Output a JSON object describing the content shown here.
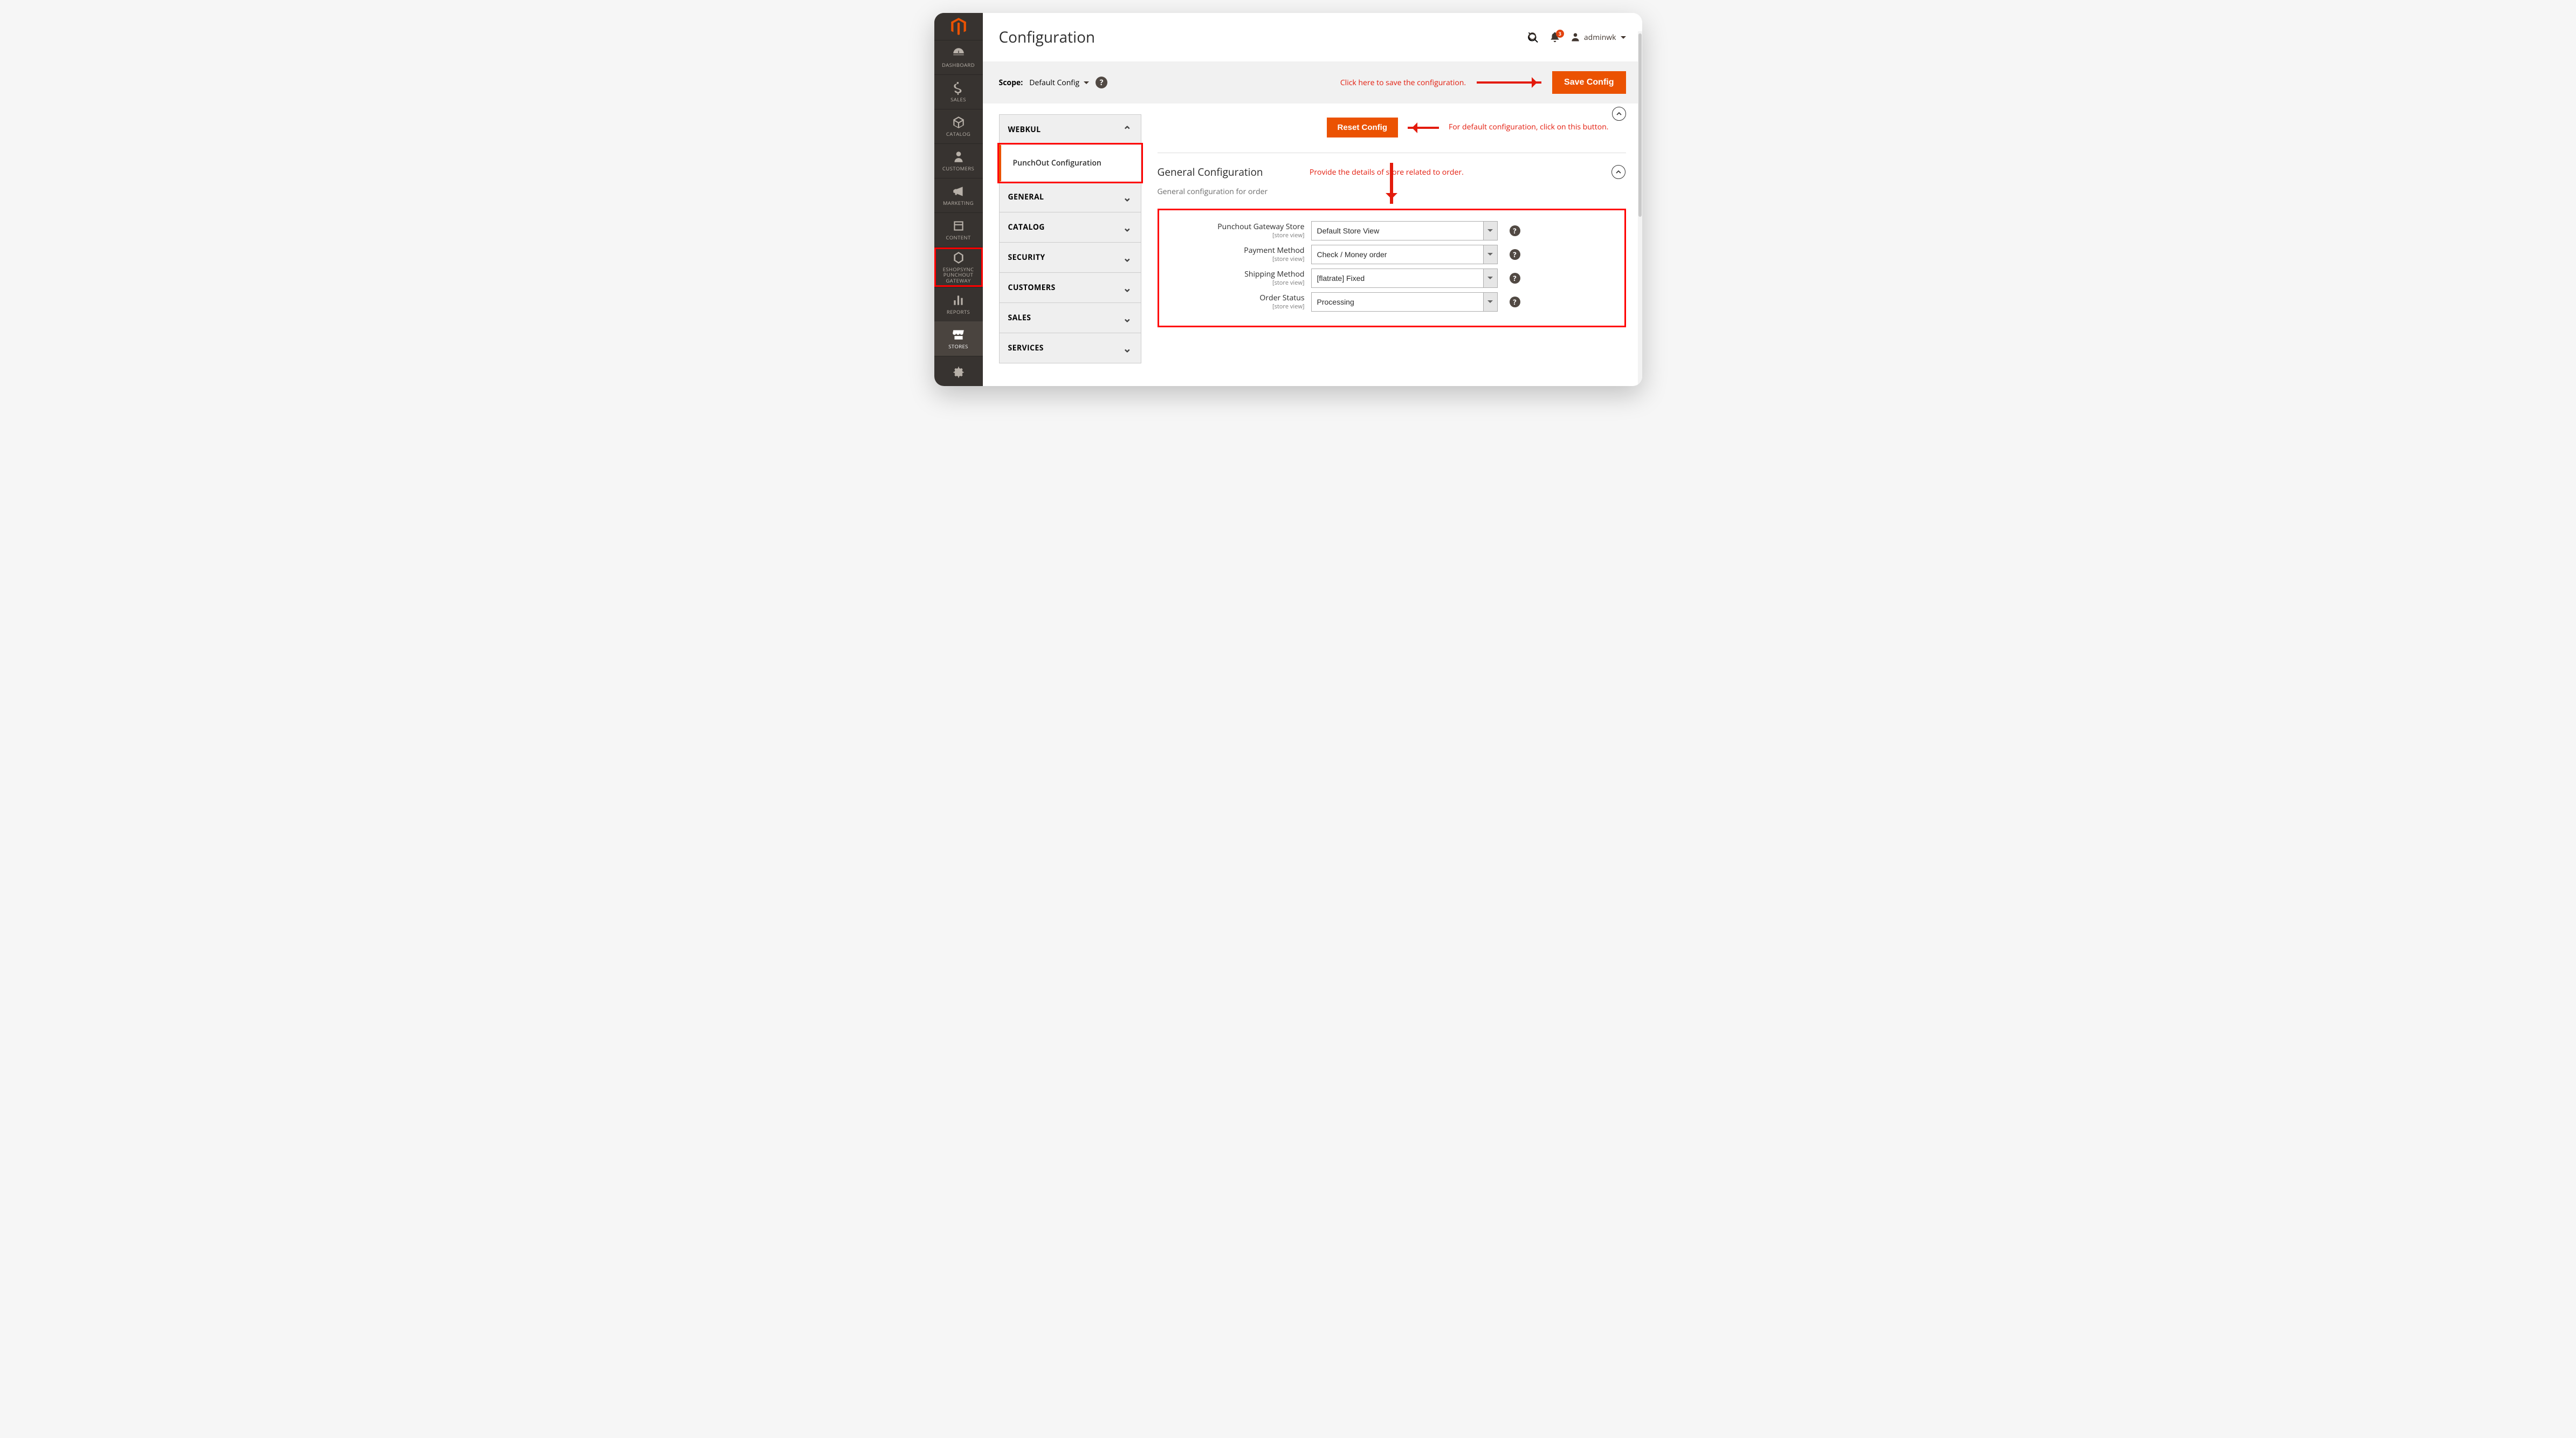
{
  "page_title": "Configuration",
  "scope": {
    "label": "Scope:",
    "value": "Default Config"
  },
  "buttons": {
    "save_config": "Save Config",
    "reset_config": "Reset Config"
  },
  "annotations": {
    "save": "Click here to save the configuration.",
    "reset": "For default configuration, click on this button.",
    "general": "Provide the details of store related to order."
  },
  "admin_user": {
    "name": "adminwk",
    "notification_count": "3"
  },
  "sidebar": {
    "items": [
      {
        "key": "dashboard",
        "label": "DASHBOARD"
      },
      {
        "key": "sales",
        "label": "SALES"
      },
      {
        "key": "catalog",
        "label": "CATALOG"
      },
      {
        "key": "customers",
        "label": "CUSTOMERS"
      },
      {
        "key": "marketing",
        "label": "MARKETING"
      },
      {
        "key": "content",
        "label": "CONTENT"
      },
      {
        "key": "eshopsync",
        "label": "ESHOPSYNC PUNCHOUT GATEWAY"
      },
      {
        "key": "reports",
        "label": "REPORTS"
      },
      {
        "key": "stores",
        "label": "STORES"
      },
      {
        "key": "system",
        "label": ""
      }
    ]
  },
  "config_tabs": {
    "group_webkul": "WEBKUL",
    "item_punchout": "PunchOut Configuration",
    "group_general": "GENERAL",
    "group_catalog": "CATALOG",
    "group_security": "SECURITY",
    "group_customers": "CUSTOMERS",
    "group_sales": "SALES",
    "group_services": "SERVICES"
  },
  "section": {
    "title": "General Configuration",
    "subtitle": "General configuration for order",
    "scope_note": "[store view]",
    "fields": {
      "store": {
        "label": "Punchout Gateway Store",
        "value": "Default Store View"
      },
      "payment": {
        "label": "Payment Method",
        "value": "Check / Money order"
      },
      "shipping": {
        "label": "Shipping Method",
        "value": "[flatrate] Fixed"
      },
      "status": {
        "label": "Order Status",
        "value": "Processing"
      }
    }
  }
}
